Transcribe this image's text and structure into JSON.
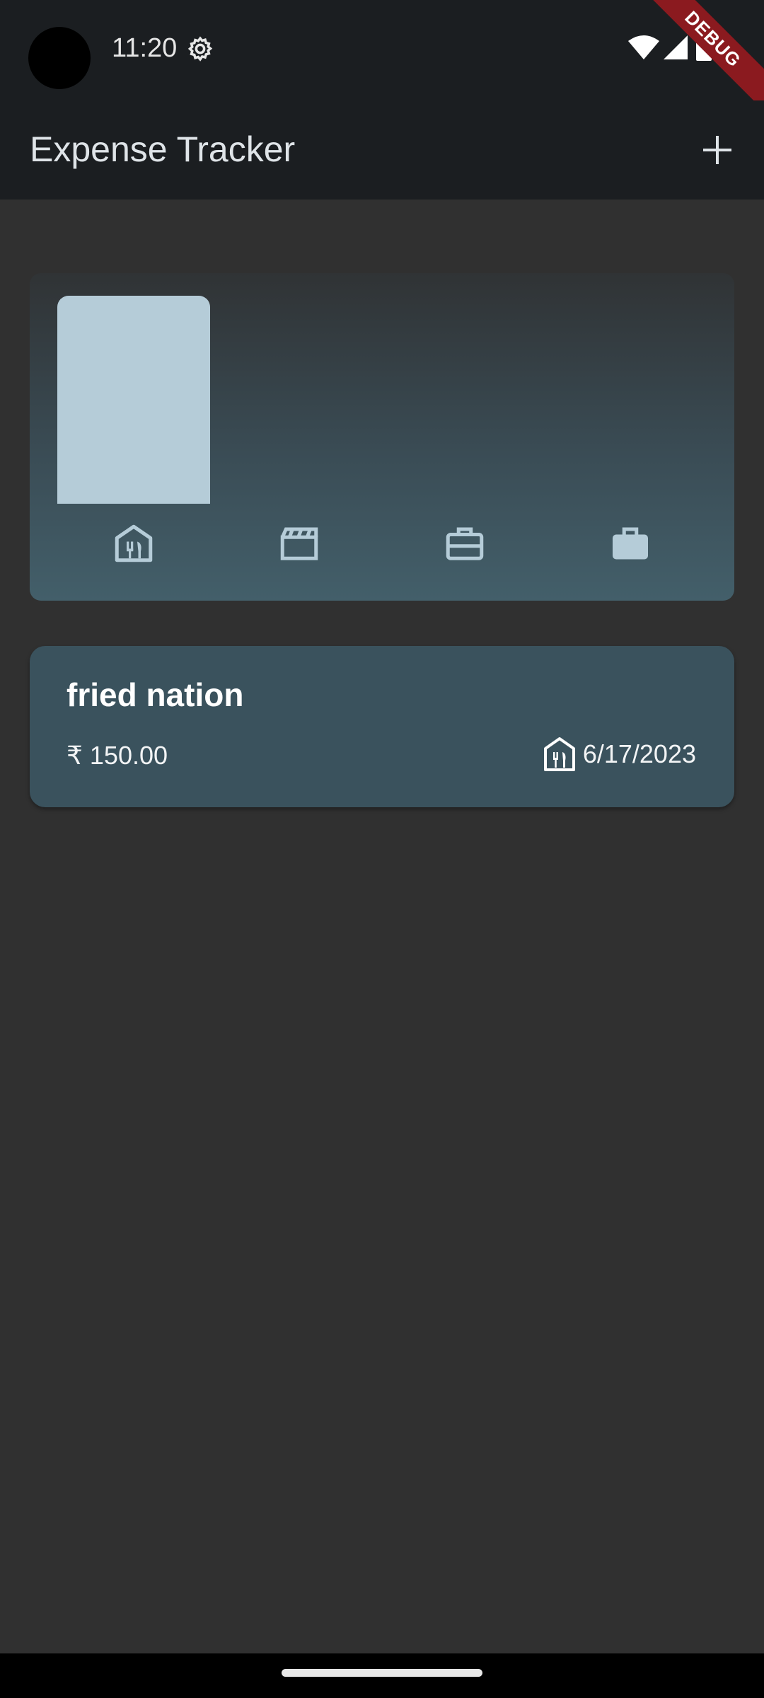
{
  "status_bar": {
    "time": "11:20"
  },
  "app_bar": {
    "title": "Expense Tracker",
    "add_icon": "plus-icon"
  },
  "debug_banner": {
    "label": "DEBUG",
    "color": "#8b1a1f"
  },
  "chart_data": {
    "type": "bar",
    "categories": [
      "food",
      "leisure",
      "travel",
      "work"
    ],
    "category_icons": [
      "food-icon",
      "movie-icon",
      "travel-icon",
      "work-icon"
    ],
    "values": [
      1,
      0,
      0,
      0
    ],
    "ylim": [
      0,
      1
    ],
    "bar_color": "#b5ccd8",
    "icon_color": "#b5ccd8"
  },
  "expenses": [
    {
      "title": "fried nation",
      "amount": "₹ 150.00",
      "category_icon": "food-icon",
      "date": "6/17/2023"
    }
  ],
  "colors": {
    "background": "#303030",
    "app_bar": "#1b1e21",
    "card": "#3a525d"
  }
}
